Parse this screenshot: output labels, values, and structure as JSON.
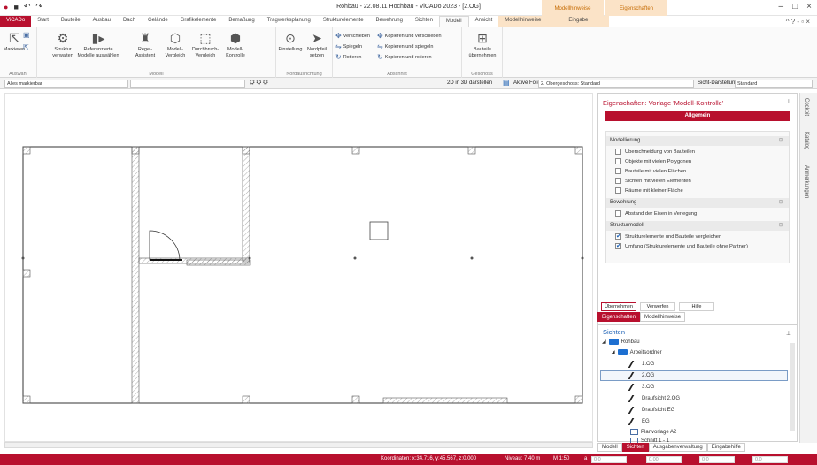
{
  "titlebar": {
    "title": "Rohbau - 22.08.11 Hochbau - ViCADo 2023 - [2.OG]",
    "ctx1": "Modellhinweise",
    "ctx2": "Eigenschaften"
  },
  "tabs": [
    "ViCADo",
    "Start",
    "Bauteile",
    "Ausbau",
    "Dach",
    "Gelände",
    "Grafikelemente",
    "Bemaßung",
    "Tragwerksplanung",
    "Strukturelemente",
    "Bewehrung",
    "Sichten",
    "Modell",
    "Ansicht",
    "Modellhinweise",
    "Eingabe"
  ],
  "ribbon": {
    "markieren": "Markieren",
    "struktur": "Struktur verwalten",
    "referenz": "Referenzierte Modelle auswählen",
    "regel": "Regel-Assistent",
    "modellvergleich": "Modell-Vergleich",
    "durchbruch": "Durchbruch-Vergleich",
    "modellkontrolle": "Modell-Kontrolle",
    "einstellung": "Einstellung",
    "nordpfeil": "Nordpfeil setzen",
    "verschieben": "Verschieben",
    "spiegeln": "Spiegeln",
    "rotieren": "Rotieren",
    "kopverschieben": "Kopieren und verschieben",
    "kopspiegeln": "Kopieren und spiegeln",
    "koprotieren": "Kopieren und rotieren",
    "bauteile": "Bauteile übernehmen",
    "g_auswahl": "Auswahl",
    "g_modell": "Modell",
    "g_nord": "Nordausrichtung",
    "g_abschnitt": "Abschnitt",
    "g_geschoss": "Geschoss"
  },
  "options": {
    "filter": "Alles markierbar",
    "twod3d": "2D in 3D darstellen",
    "folie_label": "Aktive Folie:",
    "folie": "2. Obergeschoss: Standard",
    "sicht_label": "Sicht-Darstellung:",
    "sicht": "Standard"
  },
  "props": {
    "title": "Eigenschaften: Vorlage 'Modell-Kontrolle'",
    "allgemein": "Allgemein",
    "sec1": "Modellierung",
    "m": [
      "Überschneidung von Bauteilen",
      "Objekte mit vielen Polygonen",
      "Bauteile mit vielen Flächen",
      "Sichten mit vielen Elementen",
      "Räume mit kleiner Fläche"
    ],
    "sec2": "Bewehrung",
    "b": [
      "Abstand der Eisen in Verlegung"
    ],
    "sec3": "Strukturmodell",
    "s": [
      "Strukturelemente und Bauteile vergleichen",
      "Umfang (Strukturelemente und Bauteile ohne Partner)"
    ],
    "ubernehmen": "Übernehmen",
    "verwerfen": "Verwerfen",
    "hilfe": "Hilfe"
  },
  "subtabs": [
    "Eigenschaften",
    "Modellhinweise"
  ],
  "views": {
    "title": "Sichten",
    "rohbau": "Rohbau",
    "arbeitsordner": "Arbeitsordner",
    "items": [
      "1.OG",
      "2.OG",
      "3.OG",
      "Draufsicht 2.OG",
      "Draufsicht EG",
      "EG",
      "Planvorlage A2",
      "Schnitt 1 - 1"
    ]
  },
  "bottomtabs": [
    "Modell",
    "Sichten",
    "Ausgabenverwaltung",
    "Eingabehilfe"
  ],
  "sidetabs": [
    "Cockpit",
    "Katalog",
    "Anmerkungen"
  ],
  "status": {
    "coords": "Koordinaten: x:34.716, y:45.567, z:0.000",
    "niveau": "Niveau: 7.40 m",
    "scale": "M 1:50",
    "a": "a",
    "dx": "0.0",
    "dy": "0.00",
    "w": "0.0"
  }
}
